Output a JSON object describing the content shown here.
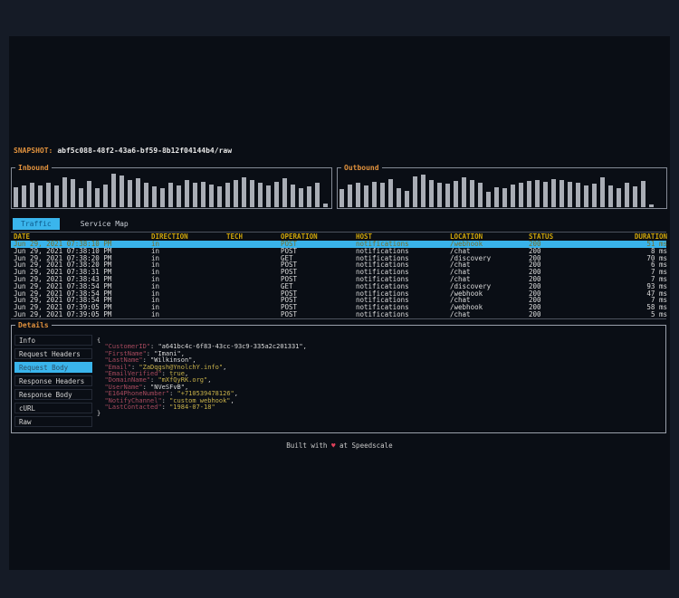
{
  "colors": {
    "background_outer": "#151b26",
    "background_window": "#0a0e15",
    "accent_cyan": "#3ab5ec",
    "label_orange": "#e0913d",
    "table_header_gold": "#cfa50a",
    "json_key_red": "#a84a5e",
    "json_value_yellow": "#c9b24a",
    "heart_red": "#e0405a",
    "bar_gray": "#a9adb5"
  },
  "snapshot": {
    "label": "SNAPSHOT:",
    "value": "abf5c088-48f2-43a6-bf59-8b12f04144b4/raw"
  },
  "chart_data": [
    {
      "type": "bar",
      "title": "Inbound",
      "xlabel": "",
      "ylabel": "request volume (unlabeled sparkline, heights in % of box)",
      "values": [
        58,
        64,
        72,
        62,
        70,
        64,
        86,
        82,
        56,
        76,
        54,
        66,
        97,
        92,
        80,
        85,
        72,
        60,
        56,
        70,
        64,
        80,
        70,
        75,
        66,
        60,
        72,
        78,
        86,
        80,
        70,
        62,
        75,
        83,
        66,
        54,
        60,
        72,
        10
      ]
    },
    {
      "type": "bar",
      "title": "Outbound",
      "xlabel": "",
      "ylabel": "request volume (unlabeled sparkline, heights in % of box)",
      "values": [
        52,
        66,
        72,
        64,
        74,
        70,
        82,
        56,
        48,
        90,
        94,
        78,
        72,
        68,
        76,
        86,
        80,
        72,
        44,
        58,
        55,
        66,
        72,
        76,
        78,
        74,
        82,
        78,
        74,
        70,
        62,
        68,
        88,
        64,
        56,
        72,
        60,
        76,
        8
      ]
    }
  ],
  "tabs": [
    {
      "label": "Traffic",
      "selected": true
    },
    {
      "label": "Service Map",
      "selected": false
    }
  ],
  "traffic_table": {
    "columns": [
      "DATE",
      "DIRECTION",
      "TECH",
      "OPERATION",
      "HOST",
      "LOCATION",
      "STATUS",
      "DURATION"
    ],
    "selected_index": 0,
    "rows": [
      [
        "Jun 29, 2021 07:38:10 PM",
        "in",
        "",
        "POST",
        "notifications",
        "/webhook",
        "200",
        "51 ms"
      ],
      [
        "Jun 29, 2021 07:38:10 PM",
        "in",
        "",
        "POST",
        "notifications",
        "/chat",
        "200",
        "8 ms"
      ],
      [
        "Jun 29, 2021 07:38:20 PM",
        "in",
        "",
        "GET",
        "notifications",
        "/discovery",
        "200",
        "70 ms"
      ],
      [
        "Jun 29, 2021 07:38:20 PM",
        "in",
        "",
        "POST",
        "notifications",
        "/chat",
        "200",
        "6 ms"
      ],
      [
        "Jun 29, 2021 07:38:31 PM",
        "in",
        "",
        "POST",
        "notifications",
        "/chat",
        "200",
        "7 ms"
      ],
      [
        "Jun 29, 2021 07:38:43 PM",
        "in",
        "",
        "POST",
        "notifications",
        "/chat",
        "200",
        "7 ms"
      ],
      [
        "Jun 29, 2021 07:38:54 PM",
        "in",
        "",
        "GET",
        "notifications",
        "/discovery",
        "200",
        "93 ms"
      ],
      [
        "Jun 29, 2021 07:38:54 PM",
        "in",
        "",
        "POST",
        "notifications",
        "/webhook",
        "200",
        "47 ms"
      ],
      [
        "Jun 29, 2021 07:38:54 PM",
        "in",
        "",
        "POST",
        "notifications",
        "/chat",
        "200",
        "7 ms"
      ],
      [
        "Jun 29, 2021 07:39:05 PM",
        "in",
        "",
        "POST",
        "notifications",
        "/webhook",
        "200",
        "58 ms"
      ],
      [
        "Jun 29, 2021 07:39:05 PM",
        "in",
        "",
        "POST",
        "notifications",
        "/chat",
        "200",
        "5 ms"
      ]
    ]
  },
  "details": {
    "label": "Details",
    "menu": [
      {
        "label": "Info",
        "selected": false
      },
      {
        "label": "Request Headers",
        "selected": false
      },
      {
        "label": "Request Body",
        "selected": true
      },
      {
        "label": "Response Headers",
        "selected": false
      },
      {
        "label": "Response Body",
        "selected": false
      },
      {
        "label": "cURL",
        "selected": false
      },
      {
        "label": "Raw",
        "selected": false
      }
    ],
    "body_open": "{",
    "body_close": "}",
    "body_entries": [
      {
        "key": "CustomerID",
        "value": "\"a641bc4c-6f83-43cc-93c9-335a2c201331\"",
        "comma": true,
        "vcolor": "white"
      },
      {
        "key": "FirstName",
        "value": "\"Imani\"",
        "comma": true,
        "vcolor": "white"
      },
      {
        "key": "LastName",
        "value": "\"Wilkinson\"",
        "comma": true,
        "vcolor": "white"
      },
      {
        "key": "Email",
        "value": "\"ZaDqgsh@YnolchY.info\"",
        "comma": true,
        "vcolor": "yellow"
      },
      {
        "key": "EmailVerified",
        "value": "true",
        "comma": true,
        "vcolor": "yellow"
      },
      {
        "key": "DomainName",
        "value": "\"mXfQyRK.org\"",
        "comma": true,
        "vcolor": "yellow"
      },
      {
        "key": "UserName",
        "value": "\"NVeSFvB\"",
        "comma": true,
        "vcolor": "white"
      },
      {
        "key": "E164PhoneNumber",
        "value": "\"+710539478126\"",
        "comma": true,
        "vcolor": "yellow"
      },
      {
        "key": "NotifyChannel",
        "value": "\"custom webhook\"",
        "comma": true,
        "vcolor": "yellow"
      },
      {
        "key": "LastContacted",
        "value": "\"1984-07-18\"",
        "comma": false,
        "vcolor": "yellow"
      }
    ]
  },
  "footer": {
    "prefix": "Built with",
    "heart": "♥",
    "suffix": "at Speedscale"
  }
}
